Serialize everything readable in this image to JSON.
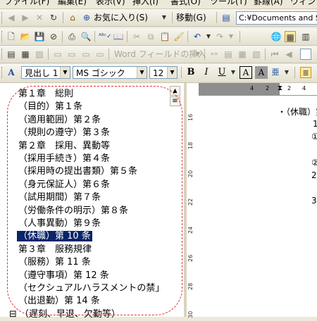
{
  "menu": [
    "ファイル(F)",
    "編集(E)",
    "表示(V)",
    "挿入(I)",
    "書式(O)",
    "ツール(T)",
    "罫線(A)",
    "ウィンド"
  ],
  "web_toolbar": {
    "favorites_label": "お気に入り(S)",
    "move_label": "移動(G)",
    "address": "C:¥Documents and Se"
  },
  "mailmerge_toolbar": {
    "insert_word_field_label": "Word フィールドの挿入"
  },
  "format_toolbar": {
    "style": "見出し 1",
    "font": "MS ゴシック",
    "size": "12",
    "bold": "B",
    "italic": "I",
    "underline": "U",
    "char_border": "A",
    "char_shade": "A"
  },
  "document_map": {
    "items": [
      {
        "text": "第１章　総則",
        "level": 1
      },
      {
        "text": "（目的）第１条",
        "level": 2
      },
      {
        "text": "（適用範囲）第２条",
        "level": 2
      },
      {
        "text": "（規則の遵守）第３条",
        "level": 2
      },
      {
        "text": "第２章　採用、異動等",
        "level": 1
      },
      {
        "text": "（採用手続き）第４条",
        "level": 2
      },
      {
        "text": "（採用時の提出書類）第５条",
        "level": 2
      },
      {
        "text": "（身元保証人）第６条",
        "level": 2
      },
      {
        "text": "（試用期間）第７条",
        "level": 2
      },
      {
        "text": "（労働条件の明示）第８条",
        "level": 2
      },
      {
        "text": "（人事異動）第９条",
        "level": 2
      },
      {
        "text": "（休職）第 10 条",
        "level": 2,
        "selected": true
      },
      {
        "text": "第３章　服務規律",
        "level": 1
      },
      {
        "text": "（服務）第 11 条",
        "level": 2
      },
      {
        "text": "（遵守事項）第 12 条",
        "level": 2
      },
      {
        "text": "（セクシュアルハラスメントの禁」",
        "level": 2
      },
      {
        "text": "（出退勤）第 14 条",
        "level": 2
      },
      {
        "text": "（遅刻、早退、欠勤等）",
        "level": 2,
        "collapsible": true
      }
    ],
    "collapse_glyph": "⊟"
  },
  "rulers": {
    "horizontal": [
      "4",
      "2",
      "2",
      "4"
    ],
    "vertical": [
      "16",
      "18",
      "20",
      "22",
      "24",
      "26",
      "28",
      "30"
    ]
  },
  "document": {
    "lines": [
      "・（休職）第",
      "1",
      "①",
      "②",
      "2",
      "3"
    ]
  }
}
